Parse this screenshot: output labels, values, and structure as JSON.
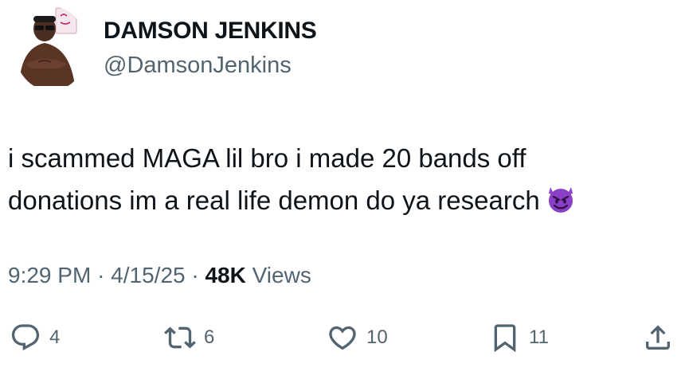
{
  "author": {
    "display_name": "DAMSON JENKINS",
    "handle": "@DamsonJenkins",
    "avatar_icon": "shirtless-man-with-sunglasses-avatar"
  },
  "tweet": {
    "text_line_1": "i scammed MAGA lil bro i made 20 bands off",
    "text_line_2": "donations im a real life demon do ya research",
    "emoji_icon": "smiling-devil-emoji"
  },
  "meta": {
    "time": "9:29 PM",
    "separator": "·",
    "date": "4/15/25",
    "views_count": "48K",
    "views_label": "Views"
  },
  "actions": {
    "replies": {
      "icon": "reply-icon",
      "count": "4"
    },
    "reposts": {
      "icon": "repost-icon",
      "count": "6"
    },
    "likes": {
      "icon": "heart-icon",
      "count": "10"
    },
    "bookmarks": {
      "icon": "bookmark-icon",
      "count": "11"
    },
    "share": {
      "icon": "share-icon"
    }
  },
  "colors": {
    "text_primary": "#0f1419",
    "text_secondary": "#536471",
    "devil_emoji": "#8a3fc7"
  }
}
